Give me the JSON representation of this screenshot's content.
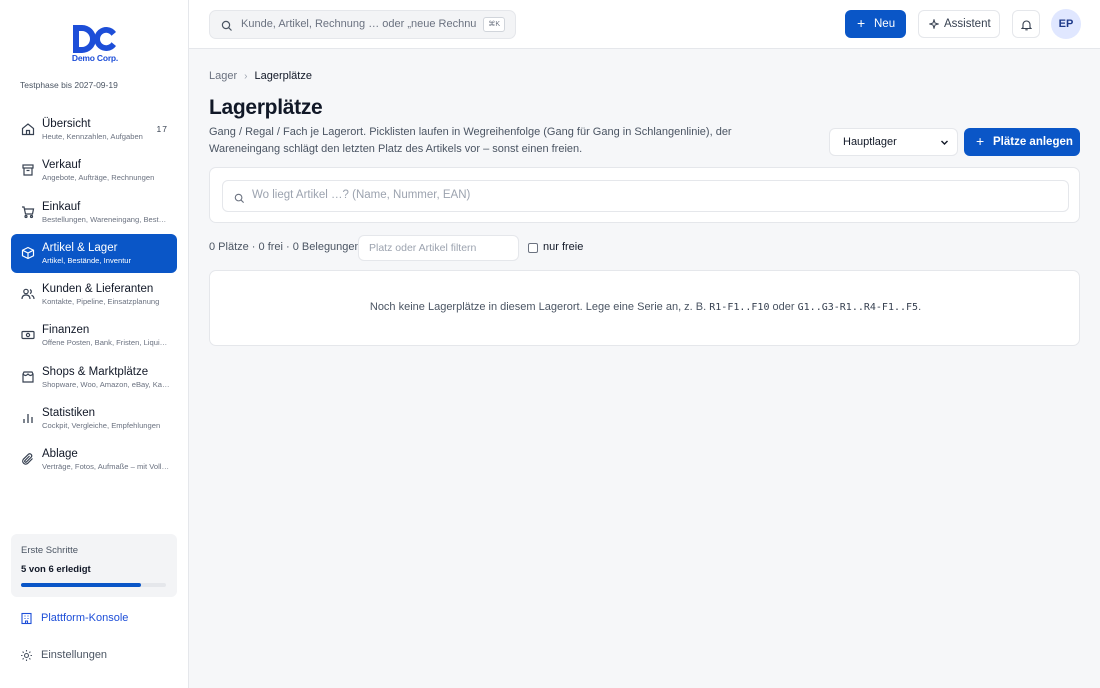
{
  "brand": {
    "name": "Demo Corp.",
    "trial": "Testphase bis 2027-09-19",
    "color": "#1d4ed8"
  },
  "sidebar": {
    "items": [
      {
        "title": "Übersicht",
        "subtitle": "Heute, Kennzahlen, Aufgaben",
        "badge": "17",
        "icon": "home-icon",
        "active": false
      },
      {
        "title": "Verkauf",
        "subtitle": "Angebote, Aufträge, Rechnungen",
        "icon": "archive-icon",
        "active": false
      },
      {
        "title": "Einkauf",
        "subtitle": "Bestellungen, Wareneingang, Bestand",
        "icon": "cart-icon",
        "active": false
      },
      {
        "title": "Artikel & Lager",
        "subtitle": "Artikel, Bestände, Inventur",
        "icon": "box-icon",
        "active": true
      },
      {
        "title": "Kunden & Lieferanten",
        "subtitle": "Kontakte, Pipeline, Einsatzplanung",
        "icon": "users-icon",
        "active": false
      },
      {
        "title": "Finanzen",
        "subtitle": "Offene Posten, Bank, Fristen, Liquidität",
        "icon": "banknote-icon",
        "active": false
      },
      {
        "title": "Shops & Marktplätze",
        "subtitle": "Shopware, Woo, Amazon, eBay, Kaufland",
        "icon": "store-icon",
        "active": false
      },
      {
        "title": "Statistiken",
        "subtitle": "Cockpit, Vergleiche, Empfehlungen",
        "icon": "bar-chart-icon",
        "active": false
      },
      {
        "title": "Ablage",
        "subtitle": "Verträge, Fotos, Aufmaße – mit Volltextsuche",
        "icon": "paperclip-icon",
        "active": false
      }
    ],
    "onboarding": {
      "title": "Erste Schritte",
      "progress_text": "5 von 6 erledigt",
      "progress": 0.83
    },
    "platform_console": "Plattform-Konsole",
    "settings": "Einstellungen"
  },
  "topbar": {
    "search_placeholder": "Kunde, Artikel, Rechnung … oder „neue Rechnung\"",
    "shortcut": "⌘K",
    "new_label": "Neu",
    "assistant_label": "Assistent",
    "avatar_initials": "EP"
  },
  "main": {
    "breadcrumb": [
      "Lager",
      "Lagerplätze"
    ],
    "title": "Lagerplätze",
    "description": "Gang / Regal / Fach je Lagerort. Picklisten laufen in Wegreihenfolge (Gang für Gang in Schlangenlinie), der Wareneingang schlägt den letzten Platz des Artikels vor – sonst einen freien.",
    "warehouse_select": "Hauptlager",
    "create_button": "Plätze anlegen",
    "item_search_placeholder": "Wo liegt Artikel …? (Name, Nummer, EAN)",
    "stats": "0 Plätze · 0 frei · 0 Belegungen",
    "filter_placeholder": "Platz oder Artikel filtern",
    "only_free_label": "nur freie",
    "empty": {
      "prefix": "Noch keine Lagerplätze in diesem Lagerort. Lege eine Serie an, z. B.",
      "example1": "R1-F1..F10",
      "middle": "oder",
      "example2": "G1..G3-R1..R4-F1..F5",
      "suffix": "."
    }
  },
  "colors": {
    "accent": "#0a56c7",
    "background": "#f6f7f9"
  }
}
